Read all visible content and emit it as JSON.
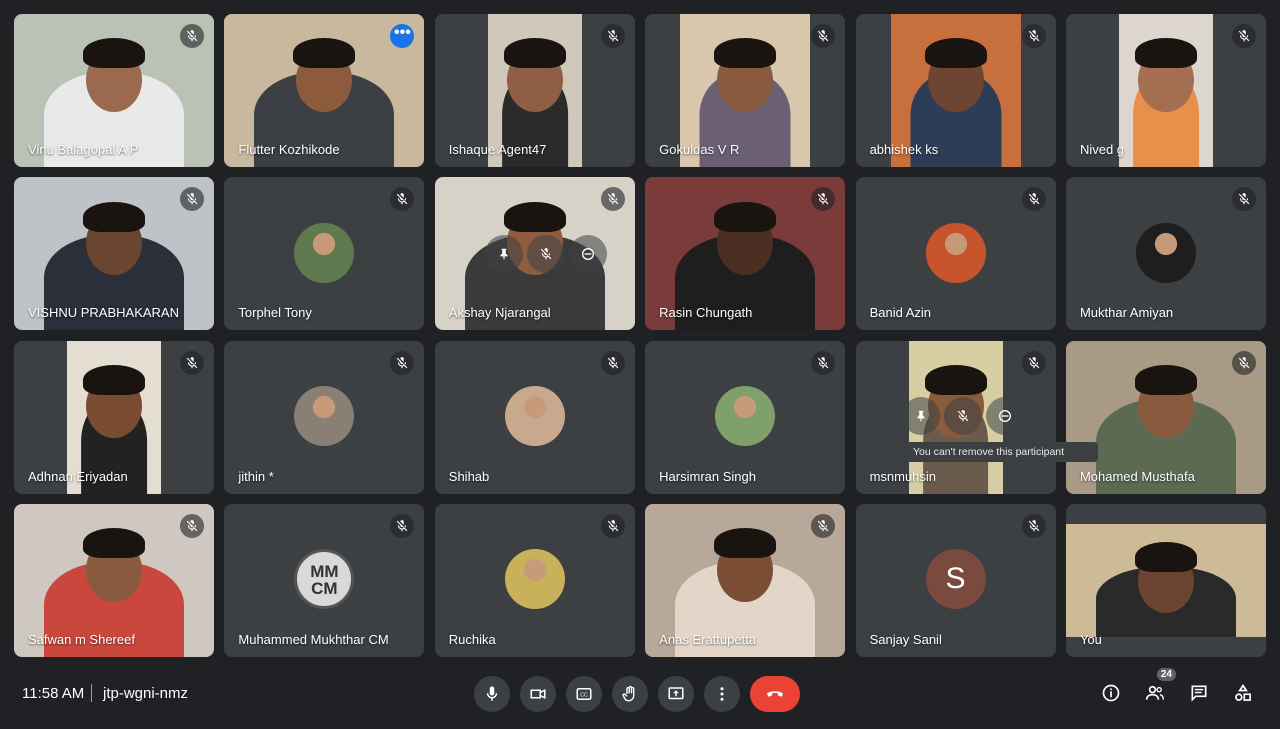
{
  "participants": [
    {
      "name": "Vinu Balagopal A P",
      "bg": "#b9c2b5",
      "skin": "#9b6a4e",
      "shirt": "#e9e9ea",
      "mode": "full"
    },
    {
      "name": "Flutter Kozhikode",
      "bg": "#c8b89d",
      "skin": "#8d5a3e",
      "shirt": "#3c3f44",
      "mode": "full",
      "active": true
    },
    {
      "name": "Ishaque Agent47",
      "bg": "#d0c9bb",
      "skin": "#8f5e44",
      "shirt": "#2b2b2b",
      "mode": "center"
    },
    {
      "name": "Gokuldas V R",
      "bg": "#d8c7ad",
      "skin": "#8a5a3e",
      "shirt": "#6b5f74",
      "mode": "wide"
    },
    {
      "name": "abhishek ks",
      "bg": "#c8703d",
      "skin": "#6e4432",
      "shirt": "#2d3d58",
      "mode": "wide"
    },
    {
      "name": "Nived g",
      "bg": "#dcd6cf",
      "skin": "#a56e50",
      "shirt": "#e7904a",
      "mode": "center"
    },
    {
      "name": "VISHNU PRABHAKARAN",
      "bg": "#bfc3c8",
      "skin": "#6a4530",
      "shirt": "#2a2f3a",
      "mode": "full"
    },
    {
      "name": "Torphel Tony",
      "avatar_bg": "#5e7a4e",
      "mode": "avatar"
    },
    {
      "name": "Akshay Njarangal",
      "bg": "#d7d2c8",
      "skin": "#8e5d40",
      "shirt": "#3a3a3a",
      "mode": "full",
      "hover": true
    },
    {
      "name": "Rasin Chungath",
      "bg": "#7a3b3a",
      "skin": "#4a2e22",
      "shirt": "#1e1e1e",
      "mode": "full"
    },
    {
      "name": "Banid Azin",
      "avatar_bg": "#c8542b",
      "mode": "avatar"
    },
    {
      "name": "Mukthar Amiyan",
      "avatar_bg": "#1e1e1e",
      "mode": "avatar"
    },
    {
      "name": "Adhnan Eriyadan",
      "bg": "#e3ddd2",
      "skin": "#7a4b33",
      "shirt": "#222",
      "mode": "center"
    },
    {
      "name": "jithin *",
      "avatar_bg": "#8a7f74",
      "mode": "avatar"
    },
    {
      "name": "Shihab",
      "avatar_bg": "#c9a98e",
      "mode": "avatar"
    },
    {
      "name": "Harsimran Singh",
      "avatar_bg": "#7fa06a",
      "mode": "avatar"
    },
    {
      "name": "msnmuhsin",
      "bg": "#d7cfa3",
      "skin": "#8b5b3e",
      "shirt": "#6b5b4c",
      "mode": "center",
      "hover2": true
    },
    {
      "name": "Mohamed Musthafa",
      "bg": "#a99a86",
      "skin": "#8a5a3e",
      "shirt": "#5c6a52",
      "mode": "full"
    },
    {
      "name": "Safwan m Shereef",
      "bg": "#cfc8c0",
      "skin": "#8a5a3e",
      "shirt": "#c9473c",
      "mode": "full"
    },
    {
      "name": "Muhammed Mukhthar CM",
      "avatar_bg": "#5c5c5c",
      "avatar_text": "MM\nCM",
      "mode": "logo"
    },
    {
      "name": "Ruchika",
      "avatar_bg": "#c9b15a",
      "mode": "avatar"
    },
    {
      "name": "Anas Erattupetta",
      "bg": "#b7a89a",
      "skin": "#7d4e36",
      "shirt": "#e3d6c9",
      "mode": "full"
    },
    {
      "name": "Sanjay Sanil",
      "letter": "S",
      "mode": "letter"
    },
    {
      "name": "You",
      "bg": "#cdbb98",
      "skin": "#6b4430",
      "shirt": "#2a2a2a",
      "mode": "you"
    }
  ],
  "tooltip": "You can't remove this participant",
  "meeting": {
    "time": "11:58 AM",
    "code": "jtp-wgni-nmz"
  },
  "participant_count": "24",
  "controls": [
    "mic-icon",
    "camera-icon",
    "captions-icon",
    "raise-hand-icon",
    "present-icon",
    "more-options-icon",
    "end-call-icon"
  ],
  "right_icons": [
    "info-icon",
    "people-icon",
    "chat-icon",
    "activities-icon"
  ]
}
